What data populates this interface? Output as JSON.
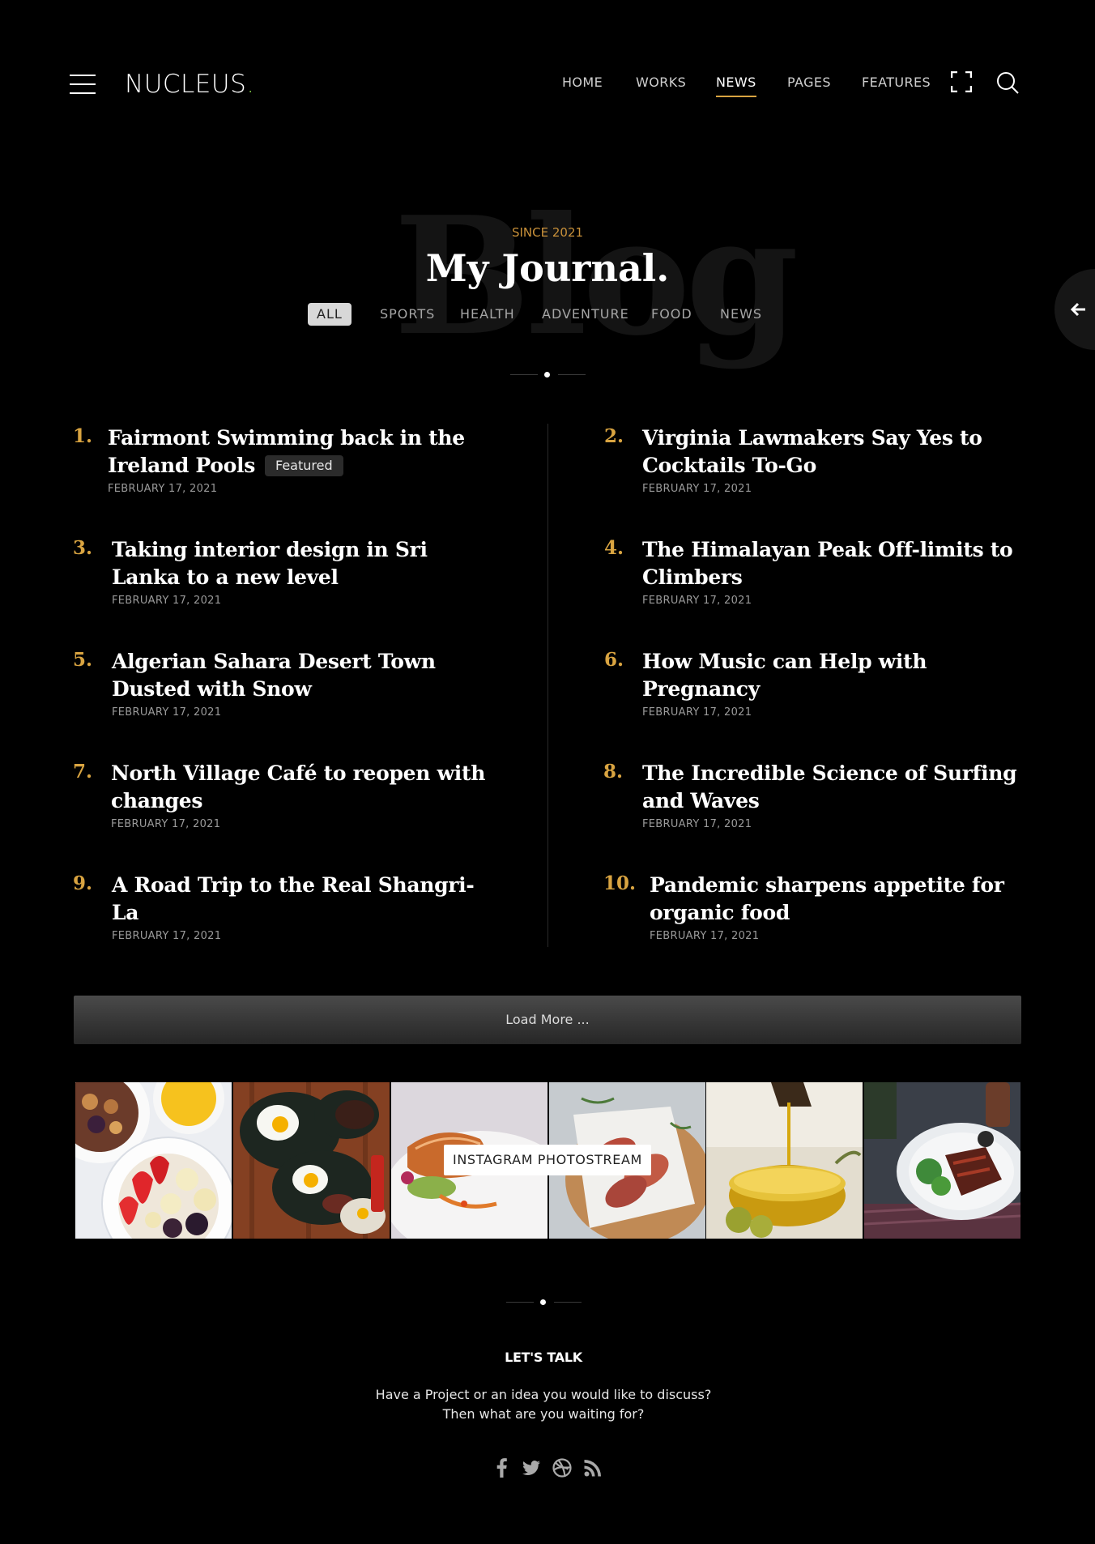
{
  "header": {
    "logo_text": "NUCLEUS",
    "logo_dot": ".",
    "nav": [
      {
        "label": "HOME"
      },
      {
        "label": "WORKS"
      },
      {
        "label": "NEWS",
        "active": true
      },
      {
        "label": "PAGES"
      },
      {
        "label": "FEATURES"
      }
    ]
  },
  "hero": {
    "background_word": "Blog",
    "since": "SINCE 2021",
    "title": "My Journal.",
    "filters": [
      "ALL",
      "SPORTS",
      "HEALTH",
      "ADVENTURE",
      "FOOD",
      "NEWS"
    ],
    "active_filter": "ALL"
  },
  "posts": [
    {
      "num": "1.",
      "title": "Fairmont Swimming back in the Ireland Pools",
      "badge": "Featured",
      "date": "FEBRUARY 17, 2021"
    },
    {
      "num": "2.",
      "title": "Virginia Lawmakers Say Yes to Cocktails To-Go",
      "date": "FEBRUARY 17, 2021"
    },
    {
      "num": "3.",
      "title": "Taking interior design in Sri Lanka to a new level",
      "date": "FEBRUARY 17, 2021"
    },
    {
      "num": "4.",
      "title": "The Himalayan Peak Off-limits to Climbers",
      "date": "FEBRUARY 17, 2021"
    },
    {
      "num": "5.",
      "title": "Algerian Sahara Desert Town Dusted with Snow",
      "date": "FEBRUARY 17, 2021"
    },
    {
      "num": "6.",
      "title": "How Music can Help with Pregnancy",
      "date": "FEBRUARY 17, 2021"
    },
    {
      "num": "7.",
      "title": "North Village Café to reopen with changes",
      "date": "FEBRUARY 17, 2021"
    },
    {
      "num": "8.",
      "title": "The Incredible Science of Surfing and Waves",
      "date": "FEBRUARY 17, 2021"
    },
    {
      "num": "9.",
      "title": "A Road Trip to the Real Shangri-La",
      "date": "FEBRUARY 17, 2021"
    },
    {
      "num": "10.",
      "title": "Pandemic sharpens appetite for organic food",
      "date": "FEBRUARY 17, 2021"
    }
  ],
  "load_more": "Load More ...",
  "instagram": {
    "label": "INSTAGRAM PHOTOSTREAM",
    "photos": [
      {
        "name": "breakfast-bowl-photo"
      },
      {
        "name": "fried-eggs-platter-photo"
      },
      {
        "name": "salmon-dish-photo"
      },
      {
        "name": "meat-rolls-photo"
      },
      {
        "name": "olive-oil-photo"
      },
      {
        "name": "steak-plate-photo"
      }
    ]
  },
  "footer": {
    "heading": "LET'S TALK",
    "line1": "Have a Project or an idea you would like to discuss?",
    "line2": "Then what are you waiting for?",
    "socials": [
      "facebook-icon",
      "twitter-icon",
      "dribbble-icon",
      "rss-icon"
    ]
  },
  "colors": {
    "background": "#000000",
    "accent": "#d9a441",
    "logo_dot": "#7bc043"
  }
}
